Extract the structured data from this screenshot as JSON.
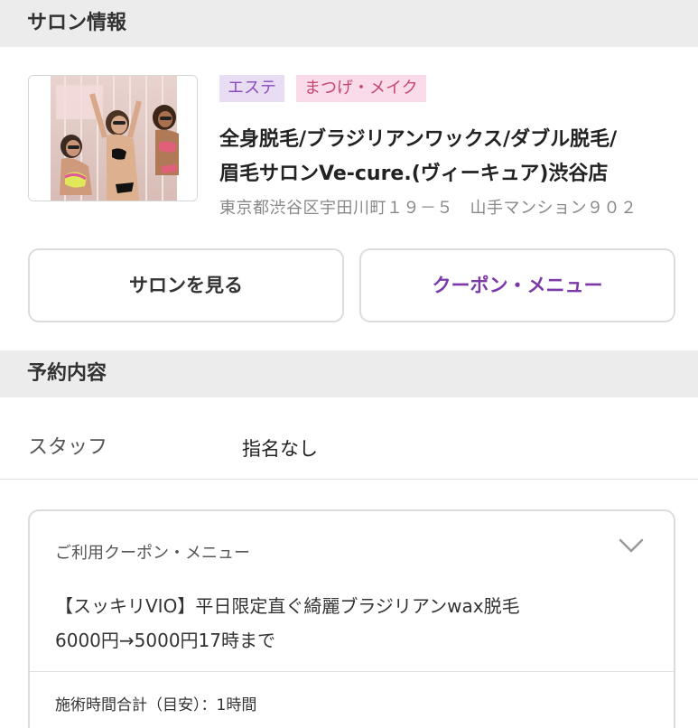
{
  "salon_section": {
    "title": "サロン情報",
    "tags": [
      "エステ",
      "まつげ・メイク"
    ],
    "name_line1": "全身脱毛/ブラジリアンワックス/ダブル脱毛/",
    "name_line2": "眉毛サロンVe-cure.(ヴィーキュア)渋谷店",
    "address": "東京都渋谷区宇田川町１９－５　山手マンション９０２",
    "view_salon_button": "サロンを見る",
    "coupon_menu_button": "クーポン・メニュー"
  },
  "reservation_section": {
    "title": "予約内容",
    "staff_label": "スタッフ",
    "staff_value": "指名なし"
  },
  "coupon_card": {
    "title": "ご利用クーポン・メニュー",
    "description_line1": "【スッキリVIO】平日限定直ぐ綺麗ブラジリアンwax脱毛",
    "description_line2": "6000円→5000円17時まで",
    "time_total": "施術時間合計（目安）：1時間"
  },
  "colors": {
    "accent_purple": "#7b3aa8",
    "tag_purple_bg": "#e8ddf2",
    "tag_pink_bg": "#fadbe9",
    "section_header_bg": "#ececec"
  }
}
